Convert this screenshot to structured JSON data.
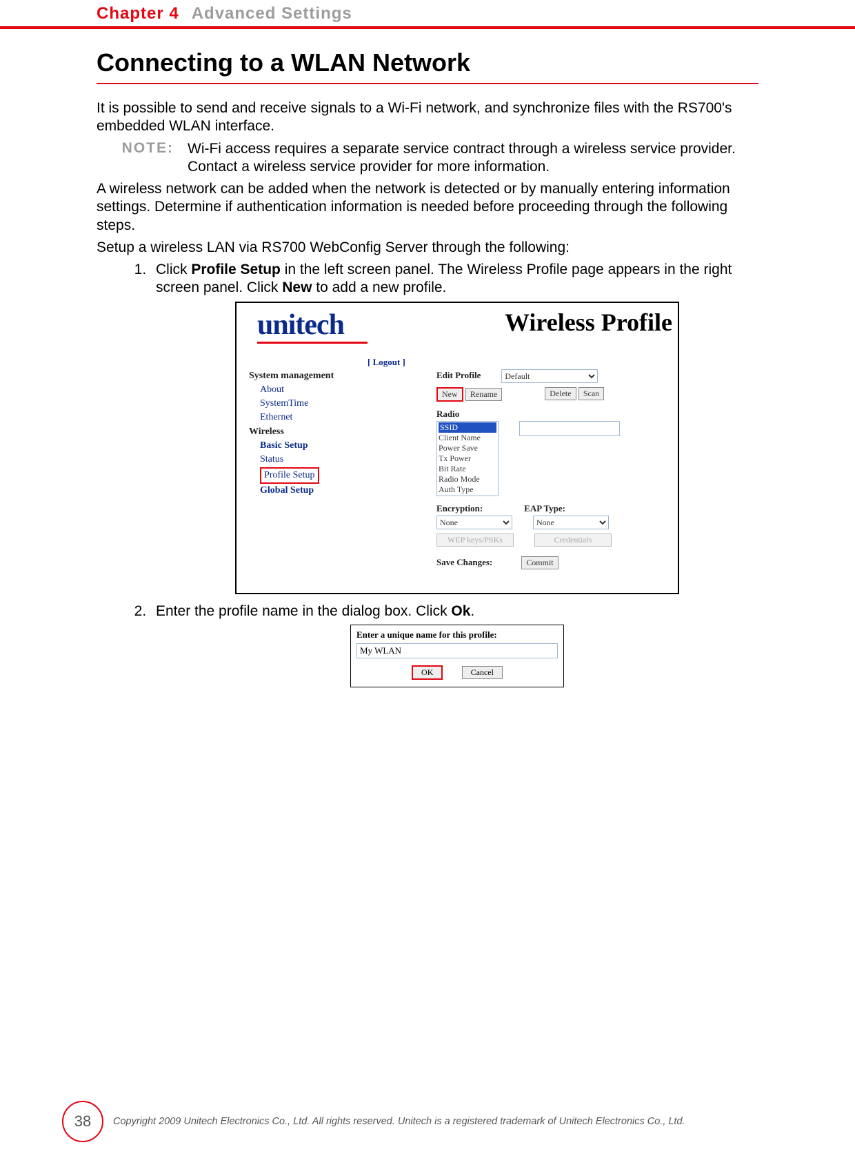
{
  "header": {
    "chapter_label": "Chapter 4",
    "chapter_title": "Advanced Settings"
  },
  "title": "Connecting to a WLAN Network",
  "intro": "It is possible to send and receive signals to a Wi-Fi network, and synchronize files with the RS700's embedded WLAN interface.",
  "note": {
    "label": "NOTE:",
    "text": "Wi-Fi access requires a separate service contract through a wireless service provider. Contact a wireless service provider for more informa­tion."
  },
  "para2": "A wireless network can be added when the network is detected or by manually enter­ing information settings. Determine if authentication information is needed before pro­ceeding through the following steps.",
  "para3": "Setup a wireless LAN via RS700 WebConfig Server through the following:",
  "steps": {
    "s1_a": "Click ",
    "s1_b": "Profile Setup",
    "s1_c": " in the left screen panel. The Wireless Profile page appears in the right screen panel. Click ",
    "s1_d": "New",
    "s1_e": " to add a new profile.",
    "s2_a": "Enter the profile name in the dialog box. Click ",
    "s2_b": "Ok",
    "s2_c": "."
  },
  "shot1": {
    "brand": "unitech",
    "title": "Wireless Profile",
    "logout": "[ Logout ]",
    "sidebar": {
      "heading": "System management",
      "about": "About",
      "systemtime": "SystemTime",
      "ethernet": "Ethernet",
      "wireless": "Wireless",
      "basic": "Basic Setup",
      "status": "Status",
      "profile": "Profile Setup",
      "global": "Global Setup"
    },
    "panel": {
      "edit_profile": "Edit Profile",
      "profile_sel": "Default",
      "new": "New",
      "rename": "Rename",
      "delete": "Delete",
      "scan": "Scan",
      "radio": "Radio",
      "radio_items": [
        "SSID",
        "Client Name",
        "Power Save",
        "Tx Power",
        "Bit Rate",
        "Radio Mode",
        "Auth Type"
      ],
      "encryption": "Encryption:",
      "enc_val": "None",
      "eap": "EAP Type:",
      "eap_val": "None",
      "wep": "WEP keys/PSKs",
      "cred": "Credentials",
      "save": "Save Changes:",
      "commit": "Commit"
    }
  },
  "shot2": {
    "prompt": "Enter a unique name for this profile:",
    "value": "My WLAN",
    "ok": "OK",
    "cancel": "Cancel"
  },
  "footer": {
    "page": "38",
    "copyright": "Copyright 2009 Unitech Electronics Co., Ltd. All rights reserved. Unitech is a registered trademark of Unitech Electronics Co., Ltd."
  }
}
